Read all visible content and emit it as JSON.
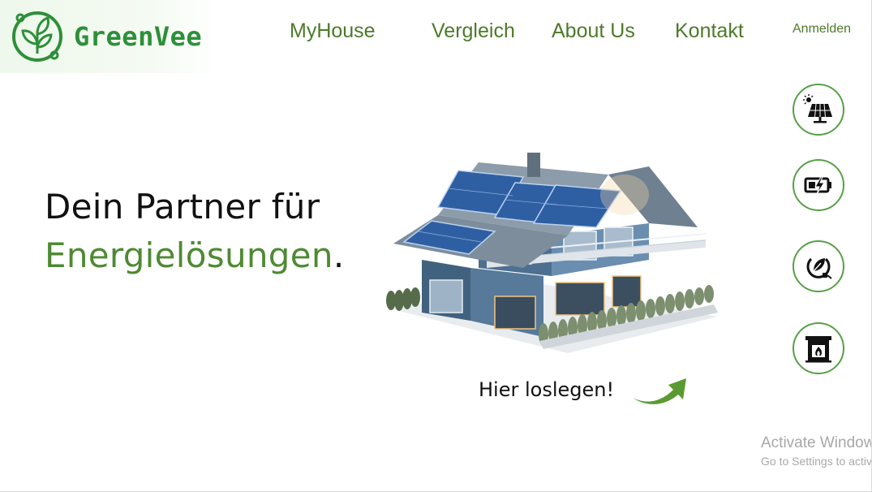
{
  "brand": {
    "name": "GreenVee",
    "color": "#2e8f3a",
    "logo_icon": "leaf-circuit-icon"
  },
  "nav": {
    "items": [
      {
        "label": "MyHouse"
      },
      {
        "label": "Vergleich"
      },
      {
        "label": "About Us"
      },
      {
        "label": "Kontakt"
      }
    ],
    "login_label": "Anmelden",
    "color": "#4d7a2a"
  },
  "hero": {
    "headline_line1": "Dein Partner für",
    "headline_line2": "Energielösungen",
    "headline_punct": ".",
    "accent_color": "#4e8a33",
    "image_icon": "solar-house-illustration",
    "cta_label": "Hier loslegen!",
    "cta_icon": "curved-arrow-right-icon"
  },
  "side_buttons": [
    {
      "icon": "solar-panel-icon"
    },
    {
      "icon": "battery-charging-icon"
    },
    {
      "icon": "energy-plug-leaf-icon"
    },
    {
      "icon": "fireplace-icon"
    }
  ],
  "watermark": {
    "title": "Activate Windows",
    "subtitle": "Go to Settings to activate Windows."
  }
}
